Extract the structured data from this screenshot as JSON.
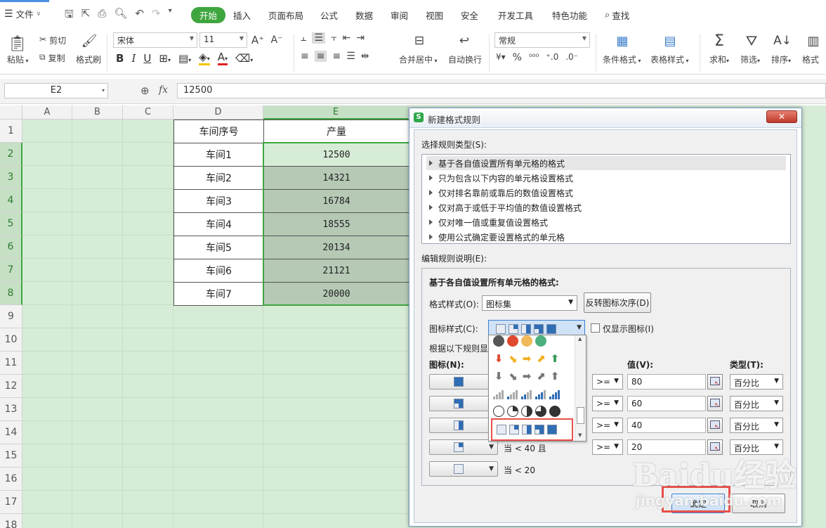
{
  "menubar": {
    "file": "文件",
    "tabs": [
      "开始",
      "插入",
      "页面布局",
      "公式",
      "数据",
      "审阅",
      "视图",
      "安全",
      "开发工具",
      "特色功能"
    ],
    "search": "查找"
  },
  "ribbon": {
    "paste": "粘贴",
    "cut": "剪切",
    "copy": "复制",
    "format_painter": "格式刷",
    "font_name": "宋体",
    "font_size": "11",
    "merge_center": "合并居中",
    "wrap_text": "自动换行",
    "number_format": "常规",
    "conditional_format": "条件格式",
    "table_style": "表格样式",
    "sum": "求和",
    "filter": "筛选",
    "sort": "排序",
    "format": "格式"
  },
  "formula_bar": {
    "cell_ref": "E2",
    "fx": "fx",
    "value": "12500"
  },
  "sheet": {
    "columns": [
      "A",
      "B",
      "C",
      "D",
      "E"
    ],
    "rows": [
      "1",
      "2",
      "3",
      "4",
      "5",
      "6",
      "7",
      "8",
      "9",
      "10",
      "11",
      "12",
      "13",
      "14",
      "15",
      "16",
      "17",
      "18"
    ],
    "header": [
      "车间序号",
      "产量"
    ],
    "data": [
      [
        "车间1",
        "12500"
      ],
      [
        "车间2",
        "14321"
      ],
      [
        "车间3",
        "16784"
      ],
      [
        "车间4",
        "18555"
      ],
      [
        "车间5",
        "20134"
      ],
      [
        "车间6",
        "21121"
      ],
      [
        "车间7",
        "20000"
      ]
    ]
  },
  "dialog": {
    "title": "新建格式规则",
    "select_rule_type": "选择规则类型(S):",
    "rule_types": [
      "基于各自值设置所有单元格的格式",
      "只为包含以下内容的单元格设置格式",
      "仅对排名靠前或靠后的数值设置格式",
      "仅对高于或低于平均值的数值设置格式",
      "仅对唯一值或重复值设置格式",
      "使用公式确定要设置格式的单元格"
    ],
    "edit_rule_desc": "编辑规则说明(E):",
    "format_all_cells": "基于各自值设置所有单元格的格式:",
    "format_style_label": "格式样式(O):",
    "format_style_value": "图标集",
    "reverse_icon_order": "反转图标次序(D)",
    "icon_style_label": "图标样式(C):",
    "show_icon_only": "仅显示图标(I)",
    "rules_label": "根据以下规则显",
    "icon_col": "图标(N):",
    "value_col": "值(V):",
    "type_col": "类型(T):",
    "ops": [
      ">=",
      ">=",
      ">=",
      ">="
    ],
    "values": [
      "80",
      "60",
      "40",
      "20"
    ],
    "types": [
      "百分比",
      "百分比",
      "百分比",
      "百分比"
    ],
    "cond_4": "当 < 40 且",
    "cond_5": "当 < 20",
    "ok": "确定",
    "cancel": "取消"
  },
  "colors": {
    "accent_green": "#3fa63f",
    "sheet_bg": "#d7ecd7",
    "highlight_red": "#e8504a",
    "icon_blue": "#2f6db5"
  },
  "watermark": {
    "brand": "Baidu经验",
    "url": "jingyan.baidu.com"
  }
}
